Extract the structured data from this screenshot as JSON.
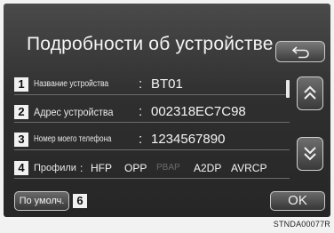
{
  "screen": {
    "title": "Подробности об устройстве",
    "back_icon": "back-arrow-icon"
  },
  "rows": [
    {
      "num": "1",
      "label": "Название устройства",
      "sep": ":",
      "value": "BT01"
    },
    {
      "num": "2",
      "label": "Адрес устройства",
      "sep": ":",
      "value": "002318EC7C98"
    },
    {
      "num": "3",
      "label": "Номер моего телефона",
      "sep": ":",
      "value": "1234567890"
    }
  ],
  "profiles": {
    "num": "4",
    "label": "Профили",
    "sep": ":",
    "items": [
      {
        "name": "HFP",
        "active": true
      },
      {
        "name": "OPP",
        "active": true
      },
      {
        "name": "PBAP",
        "active": false
      },
      {
        "name": "A2DP",
        "active": true
      },
      {
        "name": "AVRCP",
        "active": true
      }
    ]
  },
  "buttons": {
    "default_label": "По умолч.",
    "default_num": "6",
    "ok_label": "OK",
    "scroll_up_icon": "double-chevron-up-icon",
    "scroll_down_icon": "double-chevron-down-icon"
  },
  "caption": "STNDA00077R"
}
